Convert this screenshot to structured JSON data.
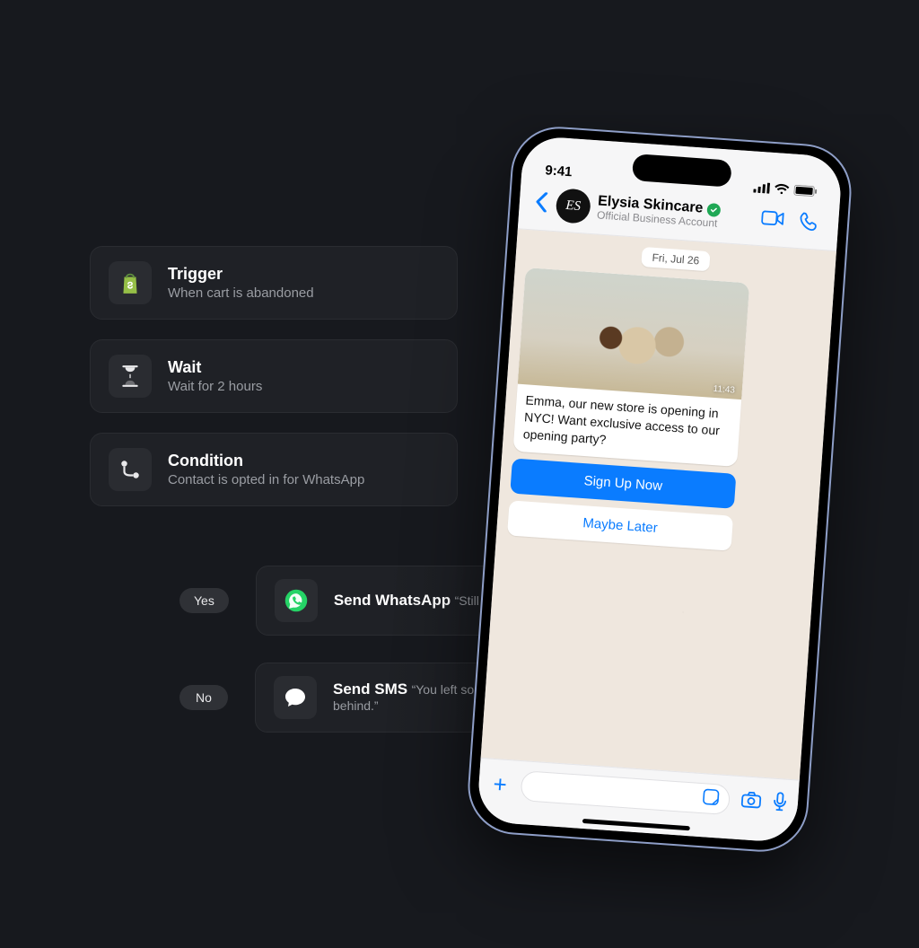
{
  "flow": {
    "trigger": {
      "title": "Trigger",
      "subtitle": "When cart is abandoned",
      "icon": "shopify-bag-icon"
    },
    "wait": {
      "title": "Wait",
      "subtitle": "Wait for 2 hours",
      "icon": "hourglass-icon"
    },
    "condition": {
      "title": "Condition",
      "subtitle": "Contact is opted in for WhatsApp",
      "icon": "branch-icon"
    },
    "branches": {
      "yes": {
        "label": "Yes",
        "card": {
          "title": "Send WhatsApp",
          "subtitle": "“Still interested?”",
          "icon": "whatsapp-icon"
        }
      },
      "no": {
        "label": "No",
        "card": {
          "title": "Send SMS",
          "subtitle": "“You left something behind.”",
          "icon": "chat-bubble-icon"
        }
      }
    }
  },
  "phone": {
    "status": {
      "time": "9:41"
    },
    "header": {
      "avatar_initials": "ES",
      "name": "Elysia Skincare",
      "subtitle": "Official Business Account",
      "verified": true
    },
    "chat": {
      "date_label": "Fri, Jul 26",
      "message": {
        "text": "Emma, our new store is opening in NYC! Want exclusive access to our opening party?",
        "image_time": "11:43"
      },
      "cta_primary": "Sign Up Now",
      "cta_secondary": "Maybe Later"
    }
  },
  "colors": {
    "bg": "#17191e",
    "card": "#1f2126",
    "whatsapp_green": "#25D366",
    "shopify_green": "#95BF47",
    "ios_blue": "#0a7cff"
  }
}
